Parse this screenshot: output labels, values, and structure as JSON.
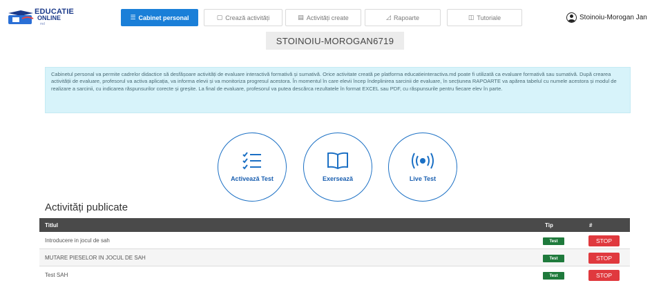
{
  "brand": {
    "line1": "EDUCATIE",
    "line2": "ONLINE",
    "tagline": "md"
  },
  "nav": [
    {
      "label": "Cabinet personal",
      "icon": "list-icon",
      "active": true
    },
    {
      "label": "Crează activități",
      "icon": "edit-icon",
      "active": false
    },
    {
      "label": "Activități create",
      "icon": "document-icon",
      "active": false
    },
    {
      "label": "Rapoarte",
      "icon": "chart-icon",
      "active": false
    },
    {
      "label": "Tutoriale",
      "icon": "book-icon",
      "active": false
    }
  ],
  "user": {
    "name": "Stoinoiu-Morogan Jan",
    "icon": "user-circle-icon"
  },
  "user_code": "STOINOIU-MOROGAN6719",
  "info_text": "Cabinetul personal va permite cadrelor didactice să desfășoare activități de evaluare interactivă formativă și sumativă. Orice activitate creată pe platforma educatieinteractiva.md poate fi utilizată ca evaluare formativă sau sumativă. După crearea activității de evaluare, profesorul va activa aplicația, va informa elevii și va monitoriza progresul acestora. În momentul în care elevii încep îndeplinirea sarcinii de evaluare, în secțiunea RAPOARTE va apărea tabelul cu numele acestora și modul de realizare a sarcinii, cu indicarea răspunsurilor corecte și greșite. La final de evaluare, profesorul va putea descărca rezultatele în format EXCEL sau PDF, cu răspunsurile pentru fiecare elev în parte.",
  "actions": [
    {
      "label": "Activează Test",
      "icon": "checklist-icon"
    },
    {
      "label": "Exersează",
      "icon": "open-book-icon"
    },
    {
      "label": "Live Test",
      "icon": "broadcast-icon"
    }
  ],
  "section_title": "Activități publicate",
  "table": {
    "columns": [
      "Titlul",
      "Tip",
      "#"
    ],
    "rows": [
      {
        "title": "Introducere in jocul de sah",
        "type": "Test",
        "action": "STOP"
      },
      {
        "title": "MUTARE PIESELOR IN JOCUL DE SAH",
        "type": "Test",
        "action": "STOP"
      },
      {
        "title": "Test SAH",
        "type": "Test",
        "action": "STOP"
      }
    ]
  },
  "colors": {
    "primary": "#1a7fd8",
    "info_bg": "#d7f3fa",
    "header_bg": "#4a4a4a",
    "badge": "#1f7a3c",
    "stop": "#e0393e"
  }
}
